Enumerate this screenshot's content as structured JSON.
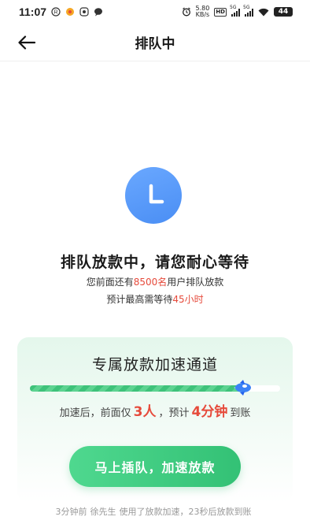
{
  "status_bar": {
    "time": "11:07",
    "net_speed_value": "5.80",
    "net_speed_unit": "KB/s",
    "hd_label": "HD",
    "signal1_label": "5G",
    "signal2_label": "5G",
    "battery": "44",
    "left_icons": [
      "r-circle-icon",
      "app-notification-icon",
      "screen-icon",
      "chat-bubble-icon"
    ]
  },
  "nav": {
    "title": "排队中"
  },
  "queue": {
    "headline": "排队放款中，请您耐心等待",
    "line1_prefix": "您前面还有",
    "line1_count": "8500名",
    "line1_suffix": "用户排队放款",
    "line2_prefix": "预计最高需等待",
    "line2_hours": "45小时"
  },
  "card": {
    "title": "专属放款加速通道",
    "progress": 0.86,
    "accel_prefix": "加速后，前面仅",
    "accel_people": "3人",
    "accel_mid": "，预计",
    "accel_minutes": "4分钟",
    "accel_suffix": "到账",
    "cta_label": "马上插队，加速放款"
  },
  "ticker": {
    "time_ago": "3分钟前",
    "user": "徐先生",
    "text": "使用了放款加速，23秒后放款到账"
  },
  "colors": {
    "accent_green": "#33c175",
    "highlight_red": "#e64a3b",
    "clock_blue": "#4a8ef4"
  }
}
